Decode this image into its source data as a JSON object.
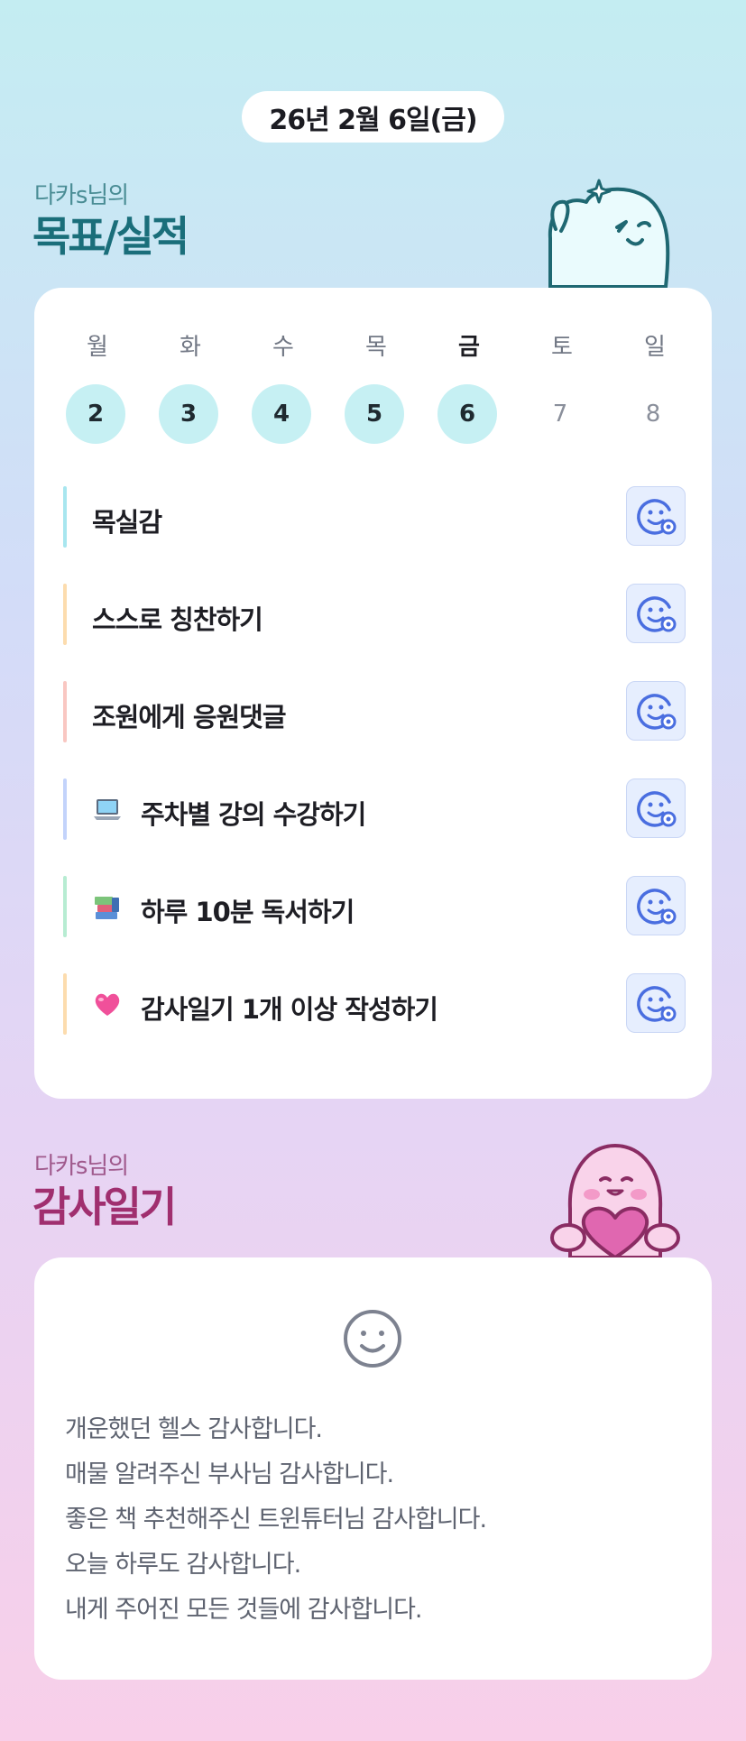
{
  "header": {
    "date": "26년 2월 6일(금)"
  },
  "goals_section": {
    "owner_label": "다카s님의",
    "title": "목표/실적"
  },
  "week": {
    "days": [
      {
        "name": "월",
        "num": "2",
        "done": true,
        "today": false
      },
      {
        "name": "화",
        "num": "3",
        "done": true,
        "today": false
      },
      {
        "name": "수",
        "num": "4",
        "done": true,
        "today": false
      },
      {
        "name": "목",
        "num": "5",
        "done": true,
        "today": false
      },
      {
        "name": "금",
        "num": "6",
        "done": true,
        "today": true
      },
      {
        "name": "토",
        "num": "7",
        "done": false,
        "today": false
      },
      {
        "name": "일",
        "num": "8",
        "done": false,
        "today": false
      }
    ]
  },
  "goals": [
    {
      "label": "목실감",
      "icon": "",
      "bar_color": "#a8e6ef"
    },
    {
      "label": "스스로 칭찬하기",
      "icon": "",
      "bar_color": "#fcdcae"
    },
    {
      "label": "조원에게 응원댓글",
      "icon": "",
      "bar_color": "#f9c7c2"
    },
    {
      "label": "주차별 강의 수강하기",
      "icon": "laptop-icon",
      "bar_color": "#c3d3fb"
    },
    {
      "label": "하루 10분 독서하기",
      "icon": "books-icon",
      "bar_color": "#b7ecd2"
    },
    {
      "label": "감사일기 1개 이상 작성하기",
      "icon": "pink-heart-icon",
      "bar_color": "#fcdcae"
    }
  ],
  "goal_action_icon": "smiley-plus-icon",
  "diary_section": {
    "owner_label": "다카s님의",
    "title": "감사일기"
  },
  "diary": {
    "mood_icon": "smiley-face-icon",
    "lines": [
      "개운했던 헬스 감사합니다.",
      "매물 알려주신 부사님 감사합니다.",
      "좋은 책 추천해주신 트윈튜터님 감사합니다.",
      "오늘 하루도 감사합니다.",
      "내게 주어진 모든 것들에 감사합니다."
    ]
  },
  "colors": {
    "accent_teal": "#1a6e7a",
    "accent_pink": "#a02f6f",
    "done_day_bg": "#c6f0f3",
    "action_icon_blue": "#4a6ee0"
  }
}
